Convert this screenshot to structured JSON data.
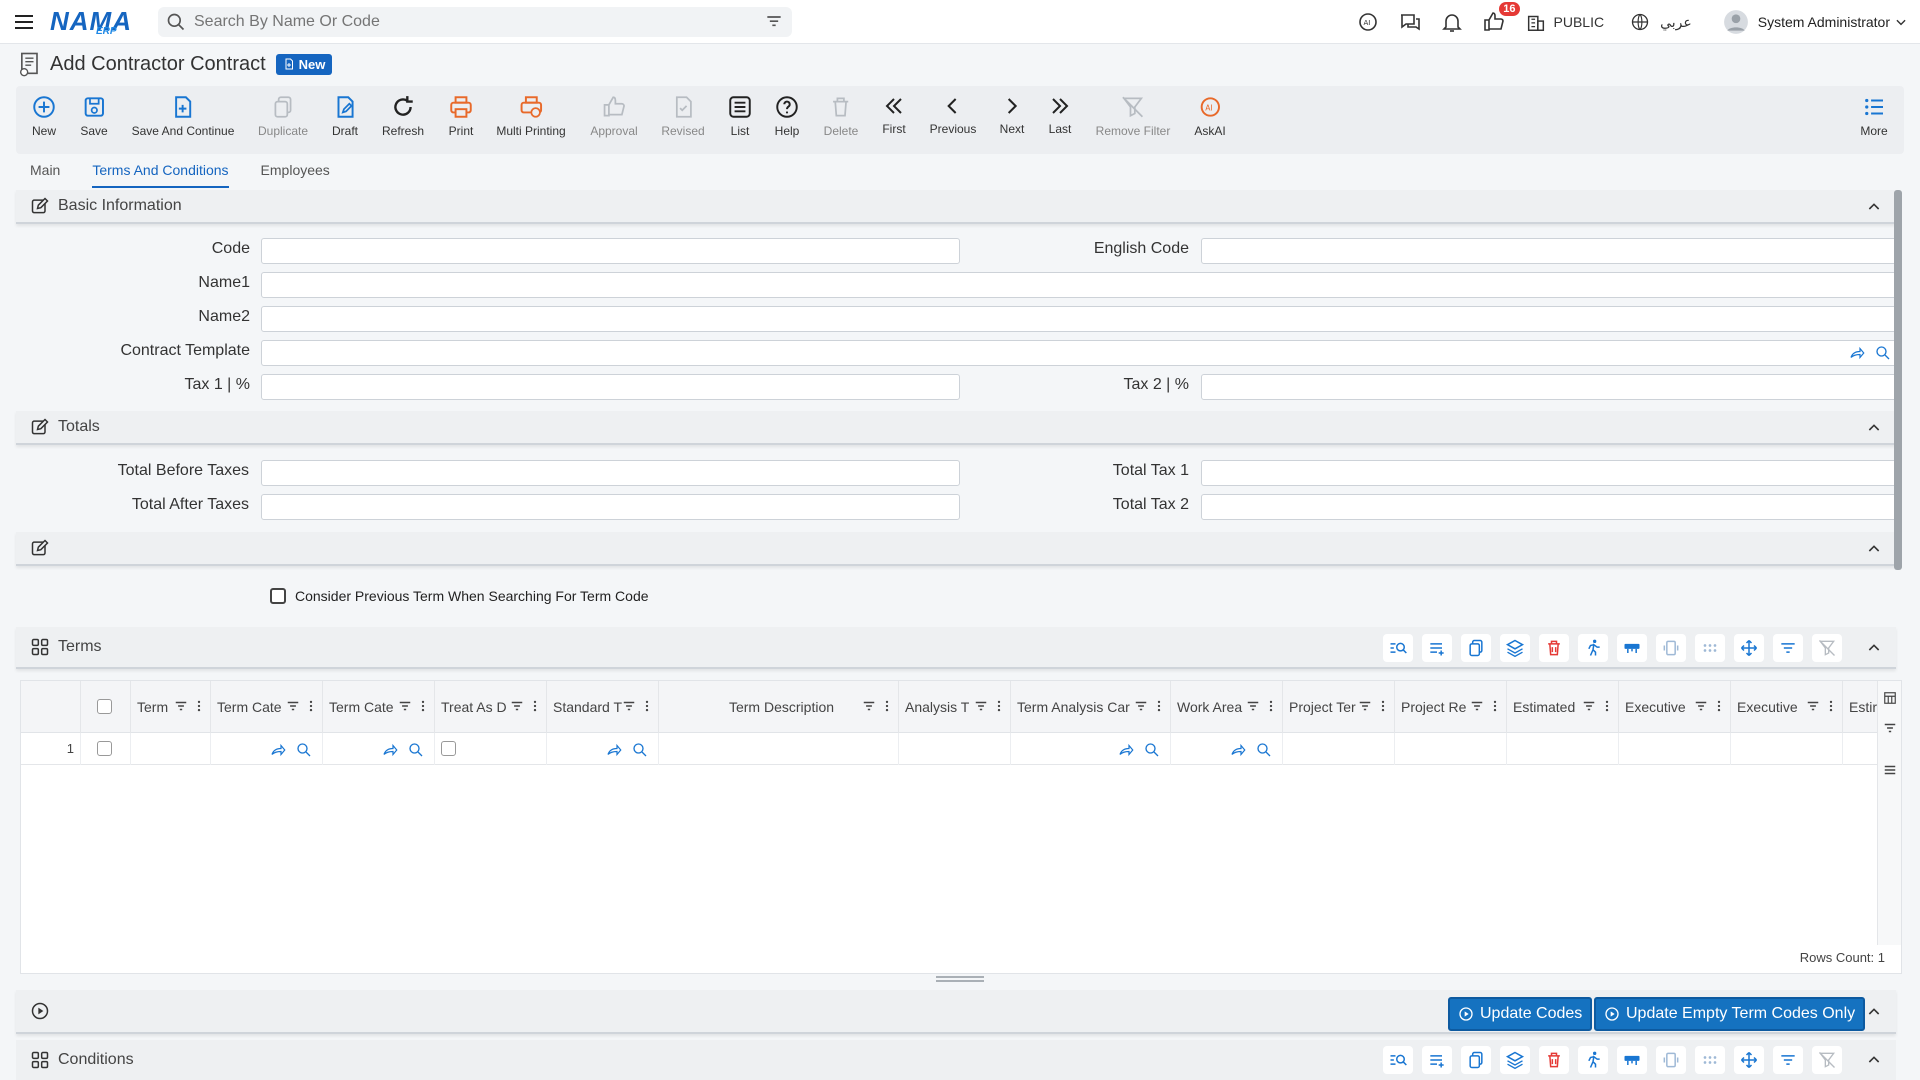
{
  "header": {
    "logo_main": "NAMA",
    "logo_sub": "ERP",
    "search_placeholder": "Search By Name Or Code",
    "notification_count": "16",
    "workspace_label": "PUBLIC",
    "language_label": "عربي",
    "user_name": "System Administrator"
  },
  "page": {
    "title": "Add Contractor Contract",
    "status_badge": "New"
  },
  "toolbar": {
    "new": "New",
    "save": "Save",
    "save_and_continue": "Save And Continue",
    "duplicate": "Duplicate",
    "draft": "Draft",
    "refresh": "Refresh",
    "print": "Print",
    "multi_printing": "Multi Printing",
    "approval": "Approval",
    "revised": "Revised",
    "list": "List",
    "help": "Help",
    "delete": "Delete",
    "first": "First",
    "previous": "Previous",
    "next": "Next",
    "last": "Last",
    "remove_filter": "Remove Filter",
    "askai": "AskAI",
    "more": "More"
  },
  "tabs": [
    "Main",
    "Terms And Conditions",
    "Employees"
  ],
  "basic_info": {
    "title": "Basic Information",
    "code_label": "Code",
    "english_code_label": "English Code",
    "name1_label": "Name1",
    "name2_label": "Name2",
    "contract_template_label": "Contract Template",
    "tax1_label": "Tax 1 | %",
    "tax2_label": "Tax 2 | %"
  },
  "totals": {
    "title": "Totals",
    "total_before_taxes_label": "Total Before Taxes",
    "total_after_taxes_label": "Total After Taxes",
    "total_tax1_label": "Total Tax 1",
    "total_tax2_label": "Total Tax 2"
  },
  "options": {
    "consider_previous_term_label": "Consider Previous Term When Searching For Term Code"
  },
  "terms": {
    "title": "Terms",
    "columns": [
      "Term",
      "Term Cate",
      "Term Cate",
      "Treat As D",
      "Standard T",
      "Term Description",
      "Analysis T",
      "Term Analysis Car",
      "Work Area",
      "Project Ter",
      "Project Re",
      "Estimated",
      "Executive",
      "Executive",
      "Estir"
    ],
    "row_number": "1",
    "rows_count": "Rows Count: 1"
  },
  "actions": {
    "update_codes": "Update Codes",
    "update_empty_term_codes": "Update Empty Term Codes Only"
  },
  "conditions": {
    "title": "Conditions"
  },
  "colors": {
    "primary": "#1565c0",
    "orange_icon": "#e8692a",
    "teal_icon": "#1976d2"
  }
}
